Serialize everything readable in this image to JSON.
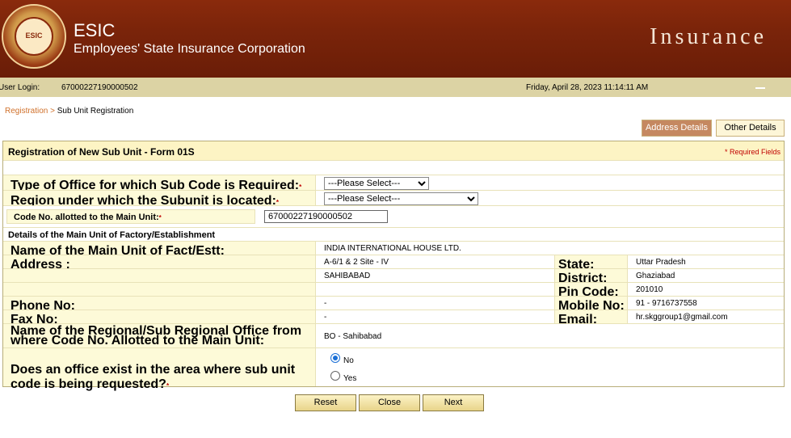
{
  "header": {
    "logo_text": "ESIC",
    "title": "ESIC",
    "subtitle": "Employees' State Insurance Corporation",
    "tagline": "Insurance"
  },
  "infobar": {
    "login_label": "User Login:",
    "login_value": "67000227190000502",
    "datetime": "Friday, April 28, 2023 11:14:11 AM"
  },
  "breadcrumb": {
    "link": "Registration >",
    "current": "Sub Unit Registration"
  },
  "tabs": {
    "active": "Address Details",
    "other": "Other Details"
  },
  "form": {
    "title": "Registration of New Sub Unit - Form 01S",
    "required_note": "* Required Fields",
    "office_type_label": "Type of Office for which Sub Code is Required:",
    "office_type_value": "---Please Select---",
    "region_label": "Region under which the Subunit is located:",
    "region_value": "---Please Select---",
    "code_label": "Code No. allotted to the Main Unit:",
    "code_value": "67000227190000502",
    "req_mark": "*",
    "details_heading": "Details of the Main Unit of Factory/Establishment",
    "name_label": "Name of the Main Unit of Fact/Estt:",
    "name_value": "INDIA INTERNATIONAL HOUSE LTD.",
    "address_label": "Address :",
    "address_line1": "A-6/1 & 2 Site - IV",
    "address_line2": "SAHIBABAD",
    "state_label": "State:",
    "state_value": "Uttar Pradesh",
    "district_label": "District:",
    "district_value": "Ghaziabad",
    "pin_label": "Pin Code:",
    "pin_value": "201010",
    "phone_label": "Phone No:",
    "phone_value": "-",
    "mobile_label": "Mobile No:",
    "mobile_value": "91 - 9716737558",
    "fax_label": "Fax No:",
    "fax_value": "-",
    "email_label": "Email:",
    "email_value": "hr.skggroup1@gmail.com",
    "office_name_label": "Name of the Regional/Sub Regional Office from where Code No. Allotted to the Main Unit:",
    "office_name_value": "BO - Sahibabad",
    "exist_label": "Does an office exist in the area where sub unit code is being requested?",
    "option_no": "No",
    "option_yes": "Yes"
  },
  "buttons": {
    "reset": "Reset",
    "close": "Close",
    "next": "Next"
  }
}
